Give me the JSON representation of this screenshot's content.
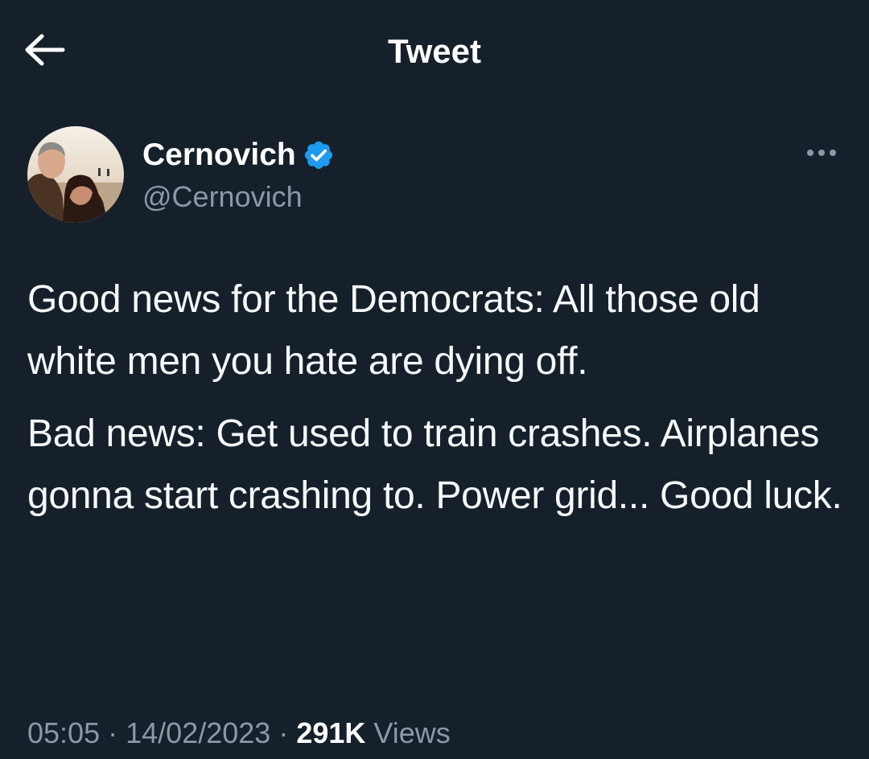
{
  "header": {
    "title": "Tweet",
    "back_icon": "arrow-left-icon"
  },
  "author": {
    "display_name": "Cernovich",
    "handle": "@Cernovich",
    "verified": true,
    "verified_color": "#1d9bf0",
    "avatar_icon": "user-avatar-photo",
    "more_icon": "more-horizontal-icon"
  },
  "tweet": {
    "paragraphs": [
      "Good news for the Democrats: All those old white men you hate are dying off.",
      "Bad news: Get used to train crashes. Airplanes gonna start crashing to. Power grid... Good luck."
    ]
  },
  "meta": {
    "time": "05:05",
    "separator": "·",
    "date": "14/02/2023",
    "views_count": "291K",
    "views_label": "Views"
  },
  "colors": {
    "background": "#15202b",
    "text_primary": "#ffffff",
    "text_secondary": "#8b98a5",
    "accent": "#1d9bf0"
  }
}
